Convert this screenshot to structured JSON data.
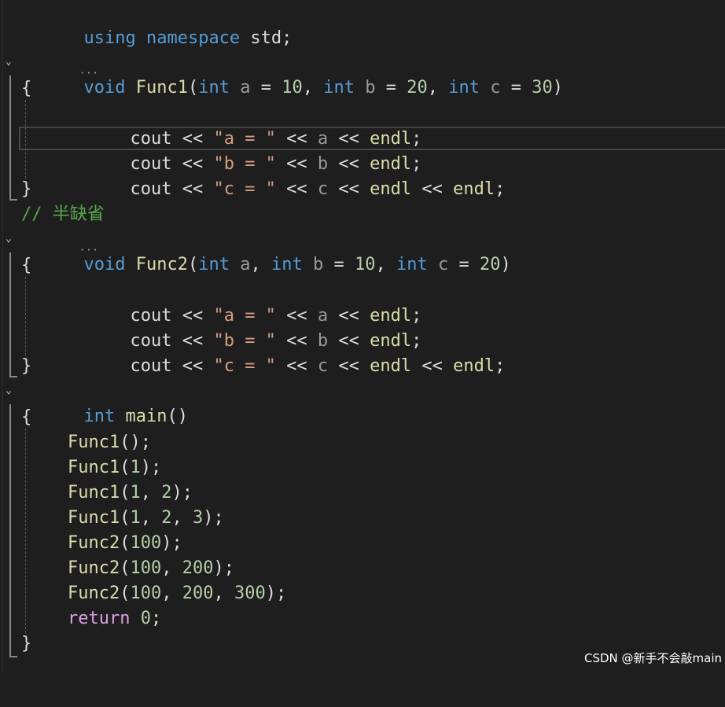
{
  "lines": {
    "l1": [
      "using",
      " ",
      "namespace",
      " std;"
    ],
    "l3": [
      "void",
      " ",
      "Func1",
      "(",
      "int",
      " ",
      "a",
      " = ",
      "10",
      ", ",
      "int",
      " ",
      "b",
      " = ",
      "20",
      ", ",
      "int",
      " ",
      "c",
      " = ",
      "30",
      ")"
    ],
    "brace": "{",
    "brace_close": "}",
    "cout_a": [
      "cout",
      " << ",
      "\"a = \"",
      " << ",
      "a",
      " << ",
      "endl",
      ";"
    ],
    "cout_b": [
      "cout",
      " << ",
      "\"b = \"",
      " << ",
      "b",
      " << ",
      "endl",
      ";"
    ],
    "cout_c": [
      "cout",
      " << ",
      "\"c = \"",
      " << ",
      "c",
      " << ",
      "endl",
      " << ",
      "endl",
      ";"
    ],
    "comment": "// 半缺省",
    "l9": [
      "void",
      " ",
      "Func2",
      "(",
      "int",
      " ",
      "a",
      ", ",
      "int",
      " ",
      "b",
      " = ",
      "10",
      ", ",
      "int",
      " ",
      "c",
      " = ",
      "20",
      ")"
    ],
    "main": [
      "int",
      " ",
      "main",
      "()"
    ],
    "calls": [
      [
        "Func1",
        "();"
      ],
      [
        "Func1",
        "(",
        "1",
        ");"
      ],
      [
        "Func1",
        "(",
        "1",
        ", ",
        "2",
        ");"
      ],
      [
        "Func1",
        "(",
        "1",
        ", ",
        "2",
        ", ",
        "3",
        ");"
      ],
      [
        "Func2",
        "(",
        "100",
        ");"
      ],
      [
        "Func2",
        "(",
        "100",
        ", ",
        "200",
        ");"
      ],
      [
        "Func2",
        "(",
        "100",
        ", ",
        "200",
        ", ",
        "300",
        ");"
      ]
    ],
    "ret": [
      "return",
      " ",
      "0",
      ";"
    ]
  },
  "fold_icon": "chevron-down-icon",
  "watermark": "CSDN @新手不会敲main",
  "colors": {
    "background": "#1e1e1e",
    "keyword": "#569cd6",
    "function": "#dcdcaa",
    "number": "#b5cea8",
    "string": "#d69d85",
    "comment": "#57a64a",
    "control": "#d8a0df"
  }
}
